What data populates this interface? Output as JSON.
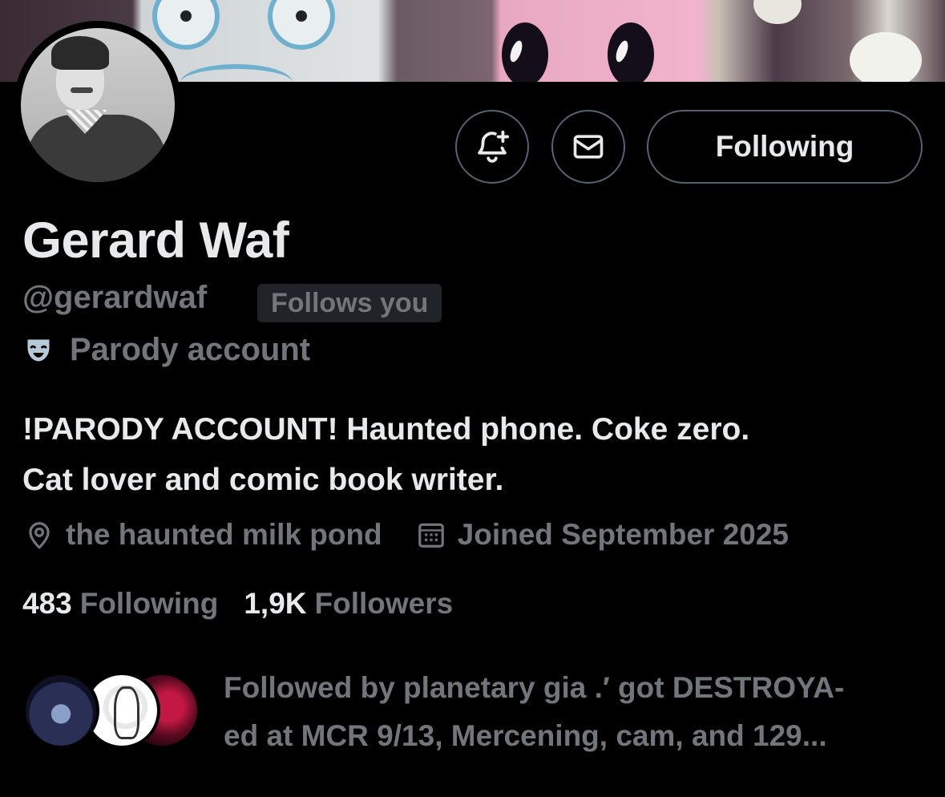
{
  "profile": {
    "display_name": "Gerard Waf",
    "handle": "@gerardwaf",
    "follows_you_badge": "Follows you",
    "parody_label": "Parody account",
    "bio_lines": [
      "!PARODY ACCOUNT! Haunted phone. Coke zero.",
      "Cat lover and comic book writer."
    ],
    "location": "the haunted milk pond",
    "joined": "Joined September 2025"
  },
  "actions": {
    "follow_button_label": "Following",
    "notifications_icon": "bell-plus-icon",
    "message_icon": "mail-icon"
  },
  "stats": {
    "following_count": "483",
    "following_label": "Following",
    "followers_count": "1,9K",
    "followers_label": "Followers"
  },
  "followed_by": {
    "lines": [
      "Followed by planetary gia .′ got DESTROYA-",
      "ed at MCR 9/13, Mercening, cam, and 129..."
    ]
  },
  "icons": {
    "location": "location-pin-icon",
    "calendar": "calendar-icon",
    "parody": "theater-mask-icon"
  },
  "colors": {
    "background": "#000000",
    "primary_text": "#e7e9ea",
    "secondary_text": "#71767b",
    "border": "#536471",
    "badge_bg": "#202327",
    "mask_icon": "#b7c9d8"
  }
}
